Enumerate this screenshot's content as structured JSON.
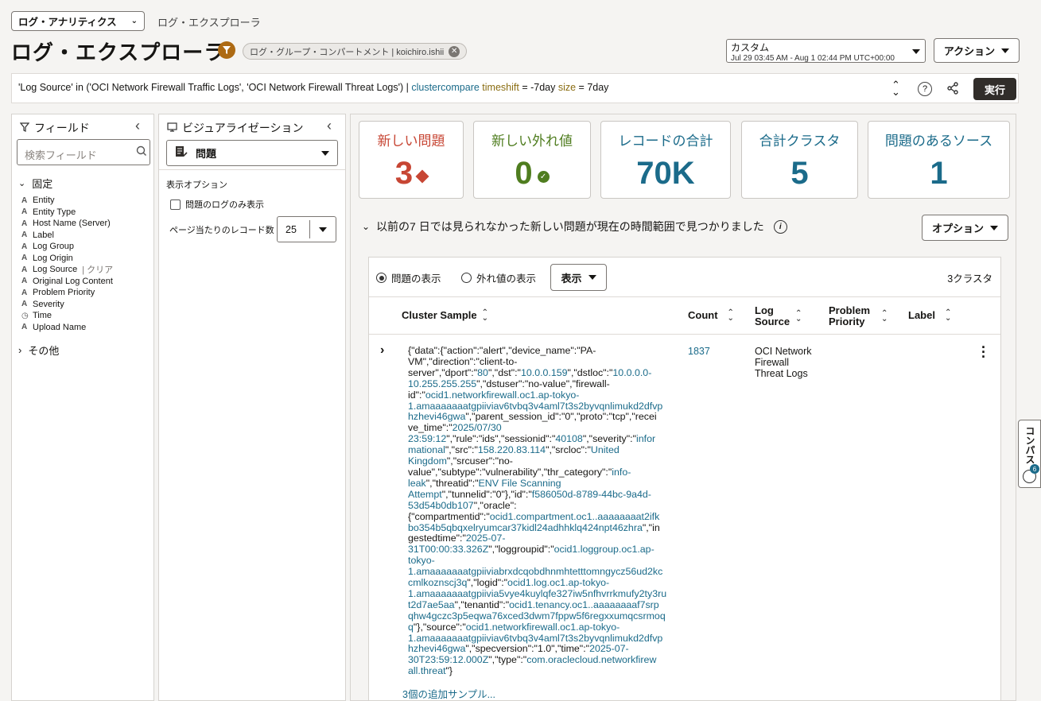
{
  "header": {
    "app_select": "ログ・アナリティクス",
    "breadcrumb": "ログ・エクスプローラ",
    "page_title": "ログ・エクスプローラ",
    "scope_chip": "ログ・グループ・コンパートメント | koichiro.ishii",
    "time_range_label": "カスタム",
    "time_range_value": "Jul 29 03:45 AM - Aug 1 02:44 PM UTC+00:00",
    "actions_label": "アクション"
  },
  "query": {
    "part1": "'Log Source' in ('OCI Network Firewall Traffic Logs', 'OCI Network Firewall Threat Logs') | ",
    "cmd": "clustercompare",
    "part2": " ",
    "kw1": "timeshift",
    "part3": " = -7day ",
    "kw2": "size",
    "part4": " = 7day",
    "run_label": "実行"
  },
  "fields_panel": {
    "title": "フィールド",
    "search_placeholder": "検索フィールド",
    "pinned_label": "固定",
    "fields": [
      "Entity",
      "Entity Type",
      "Host Name (Server)",
      "Label",
      "Log Group",
      "Log Origin",
      "Log Source",
      "Original Log Content",
      "Problem Priority",
      "Severity",
      "Time",
      "Upload Name"
    ],
    "clear_label": "| クリア",
    "other_label": "その他"
  },
  "viz_panel": {
    "title": "ビジュアライゼーション",
    "selected": "問題",
    "options_label": "表示オプション",
    "problem_only_label": "問題のログのみ表示",
    "records_per_page_label": "ページ当たりのレコード数",
    "records_per_page": "25"
  },
  "tiles": [
    {
      "title": "新しい問題",
      "value": "3",
      "color": "#c74634"
    },
    {
      "title": "新しい外れ値",
      "value": "0",
      "color": "#4f7d1f"
    },
    {
      "title": "レコードの合計",
      "value": "70K",
      "color": "#1b6b8a"
    },
    {
      "title": "合計クラスタ",
      "value": "5",
      "color": "#1b6b8a"
    },
    {
      "title": "問題のあるソース",
      "value": "1",
      "color": "#1b6b8a"
    }
  ],
  "section": {
    "heading": "以前の7 日では見られなかった新しい問題が現在の時間範囲で見つかりました",
    "options_label": "オプション"
  },
  "cluster_table": {
    "radio_problems": "問題の表示",
    "radio_outliers": "外れ値の表示",
    "display_label": "表示",
    "cluster_count": "3クラスタ",
    "columns": [
      "Cluster Sample",
      "Count",
      "Log Source",
      "Problem Priority",
      "Label"
    ],
    "row": {
      "count": "1837",
      "log_source": "OCI Network Firewall Threat Logs",
      "more_samples": "3個の追加サンプル..."
    }
  },
  "compass_label": "コンパス",
  "compass_badge": "6"
}
